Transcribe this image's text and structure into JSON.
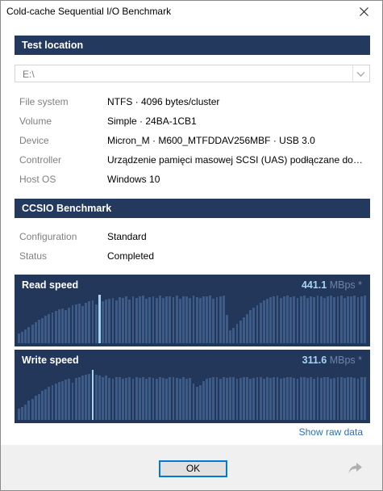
{
  "window": {
    "title": "Cold-cache Sequential I/O Benchmark"
  },
  "icons": {
    "close": "close-icon",
    "dropdown": "chevron-down-icon",
    "share": "share-arrow-icon"
  },
  "colors": {
    "header_bg": "#24395e",
    "panel_bg": "#23375b",
    "bar": "#3c5b86",
    "bar_highlight": "#a8d4f4",
    "link": "#2c6fbf",
    "focus": "#0078d7"
  },
  "test_location": {
    "header": "Test location",
    "drive": "E:\\",
    "rows": [
      {
        "label": "File system",
        "value": "NTFS  ·  4096 bytes/cluster"
      },
      {
        "label": "Volume",
        "value": "Simple  ·  24BA-1CB1"
      },
      {
        "label": "Device",
        "value": "Micron_M  ·  M600_MTFDDAV256MBF  ·  USB 3.0"
      },
      {
        "label": "Controller",
        "value": "Urządzenie pamięci masowej SCSI (UAS) podłączane do port..."
      },
      {
        "label": "Host OS",
        "value": "Windows 10"
      }
    ]
  },
  "benchmark": {
    "header": "CCSIO Benchmark",
    "rows": [
      {
        "label": "Configuration",
        "value": "Standard"
      },
      {
        "label": "Status",
        "value": "Completed"
      }
    ]
  },
  "read": {
    "title": "Read speed",
    "value": "441.1",
    "unit": "MBps *",
    "highlight_index": 24,
    "levels": [
      0.2,
      0.24,
      0.28,
      0.34,
      0.38,
      0.44,
      0.48,
      0.52,
      0.56,
      0.6,
      0.64,
      0.66,
      0.7,
      0.72,
      0.68,
      0.74,
      0.78,
      0.8,
      0.82,
      0.76,
      0.84,
      0.86,
      0.88,
      0.8,
      0.92,
      0.86,
      0.9,
      0.92,
      0.94,
      0.88,
      0.95,
      0.93,
      0.96,
      0.9,
      0.97,
      0.94,
      0.96,
      0.98,
      0.92,
      0.95,
      0.97,
      0.94,
      0.98,
      0.93,
      0.96,
      0.97,
      0.95,
      0.98,
      0.92,
      0.96,
      0.97,
      0.94,
      0.98,
      0.95,
      0.93,
      0.97,
      0.96,
      0.98,
      0.92,
      0.95,
      0.97,
      0.98,
      0.58,
      0.26,
      0.32,
      0.4,
      0.46,
      0.54,
      0.6,
      0.68,
      0.74,
      0.78,
      0.84,
      0.88,
      0.92,
      0.95,
      0.97,
      0.98,
      0.94,
      0.96,
      0.98,
      0.95,
      0.97,
      0.93,
      0.96,
      0.98,
      0.94,
      0.97,
      0.95,
      0.98,
      0.96,
      0.93,
      0.97,
      0.98,
      0.95,
      0.96,
      0.98,
      0.94,
      0.97,
      0.96,
      0.98,
      0.95,
      0.97,
      0.98
    ]
  },
  "write": {
    "title": "Write speed",
    "value": "311.6",
    "unit": "MBps *",
    "highlight_index": 22,
    "levels": [
      0.22,
      0.26,
      0.3,
      0.38,
      0.42,
      0.48,
      0.52,
      0.58,
      0.62,
      0.66,
      0.7,
      0.72,
      0.76,
      0.78,
      0.8,
      0.82,
      0.74,
      0.84,
      0.86,
      0.88,
      0.9,
      0.92,
      0.94,
      0.9,
      0.88,
      0.86,
      0.88,
      0.84,
      0.82,
      0.86,
      0.85,
      0.83,
      0.84,
      0.86,
      0.82,
      0.85,
      0.84,
      0.86,
      0.83,
      0.85,
      0.84,
      0.82,
      0.86,
      0.84,
      0.83,
      0.85,
      0.86,
      0.84,
      0.82,
      0.85,
      0.83,
      0.84,
      0.72,
      0.66,
      0.7,
      0.78,
      0.82,
      0.84,
      0.86,
      0.85,
      0.83,
      0.86,
      0.84,
      0.85,
      0.86,
      0.83,
      0.84,
      0.85,
      0.86,
      0.82,
      0.84,
      0.85,
      0.86,
      0.83,
      0.85,
      0.84,
      0.86,
      0.85,
      0.83,
      0.84,
      0.86,
      0.85,
      0.84,
      0.83,
      0.86,
      0.85,
      0.84,
      0.86,
      0.83,
      0.85,
      0.84,
      0.86,
      0.85,
      0.83,
      0.84,
      0.86,
      0.85,
      0.84,
      0.86,
      0.85,
      0.84,
      0.83,
      0.85,
      0.86
    ]
  },
  "links": {
    "raw_data": "Show raw data"
  },
  "footer": {
    "ok_label": "OK"
  }
}
